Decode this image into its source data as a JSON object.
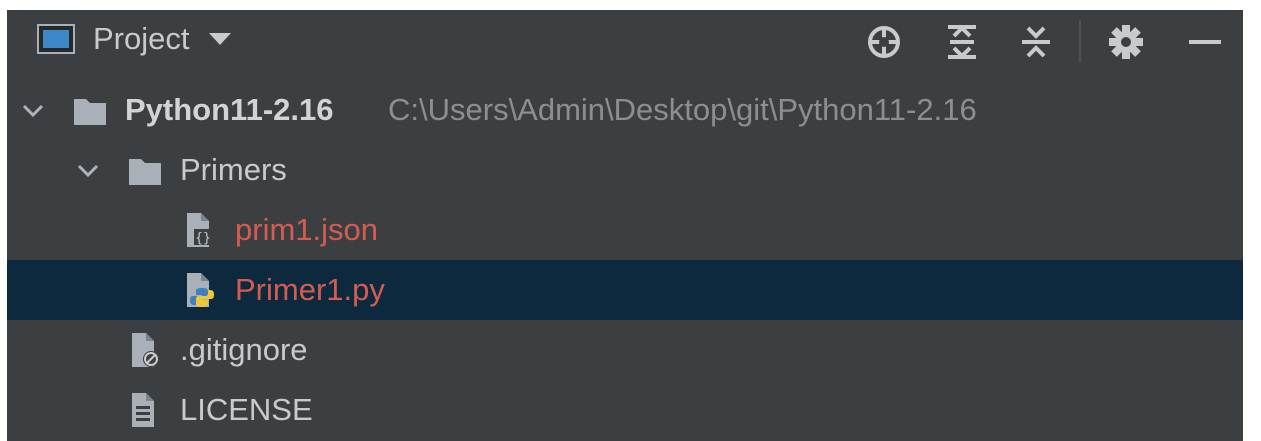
{
  "header": {
    "title": "Project",
    "window_icon": "window-icon",
    "dropdown_icon": "chevron-down-icon"
  },
  "toolbar": {
    "locate_icon": "crosshair-icon",
    "expand_all_icon": "expand-all-icon",
    "collapse_all_icon": "collapse-all-icon",
    "settings_icon": "gear-icon",
    "hide_icon": "minimize-icon"
  },
  "tree": {
    "items": [
      {
        "label": "Python11-2.16",
        "path": "C:\\Users\\Admin\\Desktop\\git\\Python11-2.16",
        "type": "folder",
        "expanded": true,
        "bold": true
      },
      {
        "label": "Primers",
        "type": "folder",
        "expanded": true
      },
      {
        "label": "prim1.json",
        "type": "json-file",
        "status": "modified"
      },
      {
        "label": "Primer1.py",
        "type": "python-file",
        "status": "modified",
        "selected": true
      },
      {
        "label": ".gitignore",
        "type": "ignore-file"
      },
      {
        "label": "LICENSE",
        "type": "text-file"
      }
    ]
  },
  "colors": {
    "panel_background": "#3c3f41",
    "selected_row": "#0d293e",
    "modified_text": "#d45d52",
    "path_text": "#8c8f92",
    "folder": "#a9b0b7",
    "window_icon_blue": "#3d87c8"
  }
}
